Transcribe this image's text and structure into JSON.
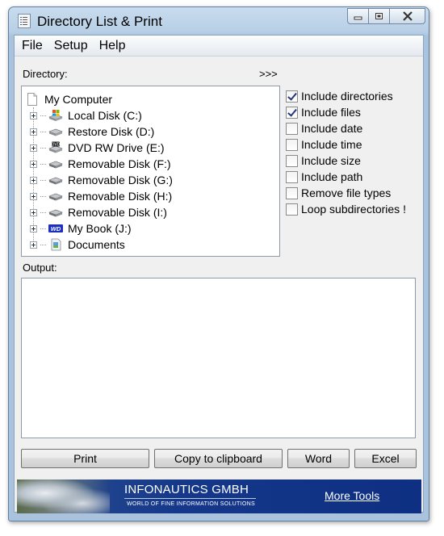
{
  "window": {
    "title": "Directory List & Print"
  },
  "menu": [
    "File",
    "Setup",
    "Help"
  ],
  "directory": {
    "label": "Directory:",
    "expand_label": ">>>",
    "root": "My Computer",
    "items": [
      {
        "label": "Local Disk (C:)",
        "icon": "local-disk-icon"
      },
      {
        "label": "Restore Disk (D:)",
        "icon": "drive-icon"
      },
      {
        "label": "DVD RW Drive (E:)",
        "icon": "dvd-drive-icon"
      },
      {
        "label": "Removable Disk (F:)",
        "icon": "removable-disk-icon"
      },
      {
        "label": "Removable Disk (G:)",
        "icon": "removable-disk-icon"
      },
      {
        "label": "Removable Disk (H:)",
        "icon": "removable-disk-icon"
      },
      {
        "label": "Removable Disk (I:)",
        "icon": "removable-disk-icon"
      },
      {
        "label": "My Book (J:)",
        "icon": "wd-drive-icon"
      },
      {
        "label": "Documents",
        "icon": "documents-icon"
      }
    ]
  },
  "options": [
    {
      "label": "Include directories",
      "checked": true
    },
    {
      "label": "Include files",
      "checked": true
    },
    {
      "label": "Include date",
      "checked": false
    },
    {
      "label": "Include time",
      "checked": false
    },
    {
      "label": "Include size",
      "checked": false
    },
    {
      "label": "Include path",
      "checked": false
    },
    {
      "label": "Remove file types",
      "checked": false
    },
    {
      "label": "Loop subdirectories !",
      "checked": false
    }
  ],
  "output": {
    "label": "Output:",
    "value": ""
  },
  "buttons": {
    "print": "Print",
    "copy": "Copy to clipboard",
    "word": "Word",
    "excel": "Excel"
  },
  "banner": {
    "company": "INFONAUTICS GMBH",
    "tagline": "WORLD OF FINE INFORMATION SOLUTIONS",
    "link": "More Tools"
  }
}
